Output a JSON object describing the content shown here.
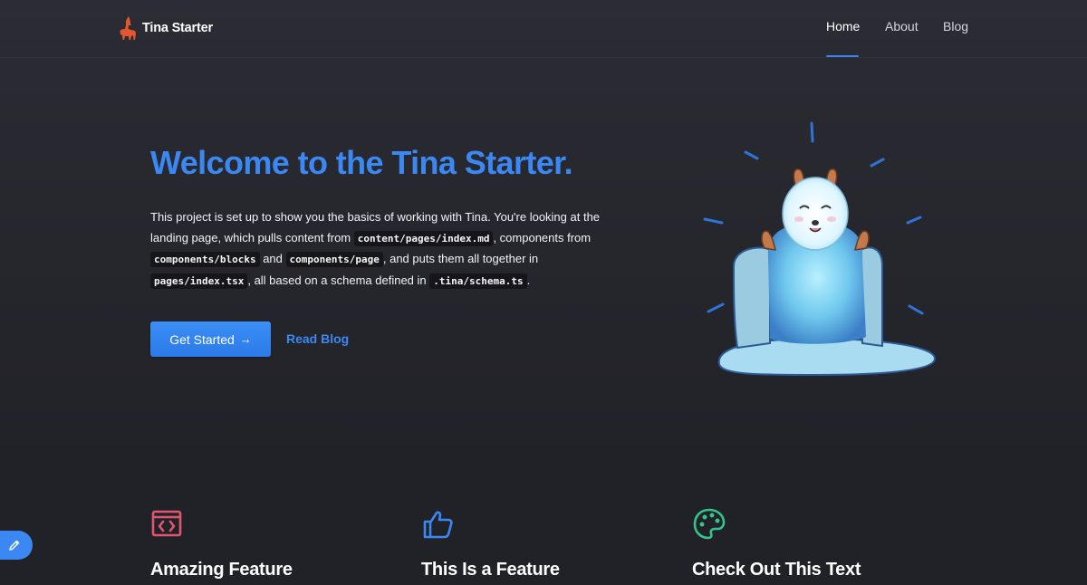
{
  "app": {
    "name": "Tina Starter",
    "accent": "#3b88f2"
  },
  "nav": {
    "items": [
      {
        "label": "Home",
        "active": true
      },
      {
        "label": "About",
        "active": false
      },
      {
        "label": "Blog",
        "active": false
      }
    ]
  },
  "hero": {
    "title": "Welcome to the Tina Starter.",
    "text": {
      "p1": "This project is set up to show you the basics of working with Tina. You're looking at the landing page, which pulls content from ",
      "code1": "content/pages/index.md",
      "p2": ", components from ",
      "code2": "components/blocks",
      "p3": " and ",
      "code3": "components/page",
      "p4": ", and puts them all together in ",
      "code4": "pages/index.tsx",
      "p5": ", all based on a schema defined in ",
      "code5": ".tina/schema.ts",
      "p6": "."
    },
    "primary_action": "Get Started",
    "primary_action_icon": "arrow-right-icon",
    "secondary_action": "Read Blog",
    "illustration": "llama-illustration"
  },
  "features": [
    {
      "title": "Amazing Feature",
      "icon": "code-icon",
      "color": "#e0566f"
    },
    {
      "title": "This Is a Feature",
      "icon": "thumbs-up-icon",
      "color": "#3b88f2"
    },
    {
      "title": "Check Out This Text",
      "icon": "palette-icon",
      "color": "#34c48b"
    }
  ],
  "edit_button": {
    "icon": "pencil-icon",
    "color": "#3b88f2"
  }
}
